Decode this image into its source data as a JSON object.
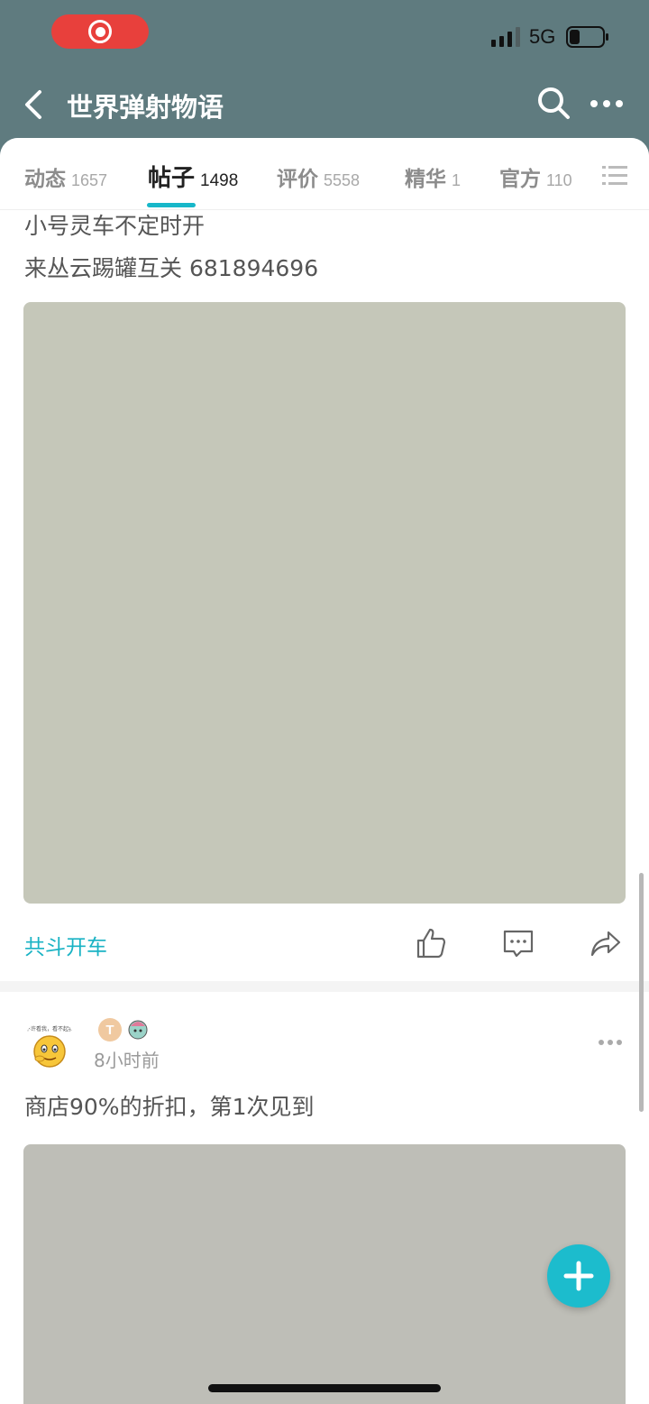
{
  "status_bar": {
    "network": "5G"
  },
  "nav": {
    "title": "世界弹射物语"
  },
  "tabs": [
    {
      "label": "动态",
      "count": "1657"
    },
    {
      "label": "帖子",
      "count": "1498"
    },
    {
      "label": "评价",
      "count": "5558"
    },
    {
      "label": "精华",
      "count": "1"
    },
    {
      "label": "官方",
      "count": "110"
    }
  ],
  "post1": {
    "line1": "小号灵车不定时开",
    "line2": "来丛云踢罐互关 681894696",
    "tag": "共斗开车"
  },
  "post2": {
    "avatar_caption": "不许看我，看不起我",
    "level_badge": "T",
    "time": "8小时前",
    "text": "商店90%的折扣，第1次见到"
  },
  "colors": {
    "header": "#5f7b7f",
    "accent": "#1ab3c4",
    "record": "#e8403c"
  },
  "icons": [
    "record-icon",
    "signal-icon",
    "battery-icon",
    "back-icon",
    "search-icon",
    "more-icon",
    "list-icon",
    "like-icon",
    "comment-icon",
    "share-icon",
    "plus-icon"
  ]
}
